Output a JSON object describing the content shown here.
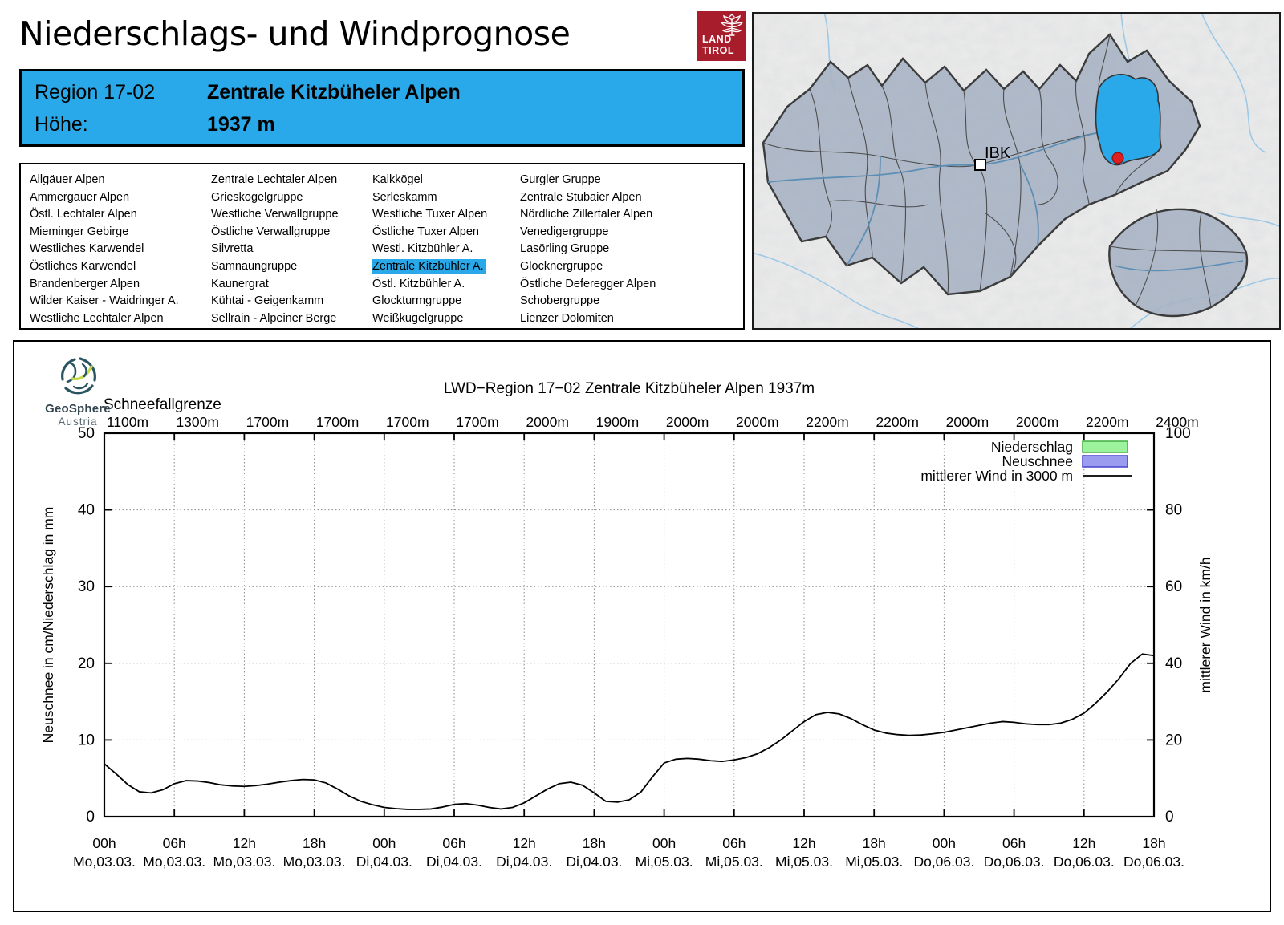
{
  "header": {
    "title": "Niederschlags- und Windprognose",
    "logo_line1": "LAND",
    "logo_line2": "TIROL",
    "logo_color": "#a81d2c"
  },
  "accent_color": "#29a9e9",
  "region_box": {
    "region_label": "Region 17-02",
    "region_name": "Zentrale Kitzbüheler Alpen",
    "hoehe_label": "Höhe:",
    "hoehe_value": "1937 m"
  },
  "region_list": {
    "columns": [
      [
        "Allgäuer Alpen",
        "Ammergauer Alpen",
        "Östl. Lechtaler Alpen",
        "Mieminger Gebirge",
        "Westliches Karwendel",
        "Östliches Karwendel",
        "Brandenberger Alpen",
        "Wilder Kaiser - Waidringer A.",
        "Westliche Lechtaler Alpen"
      ],
      [
        "Zentrale Lechtaler Alpen",
        "Grieskogelgruppe",
        "Westliche Verwallgruppe",
        "Östliche Verwallgruppe",
        "Silvretta",
        "Samnaungruppe",
        "Kaunergrat",
        "Kühtai - Geigenkamm",
        "Sellrain - Alpeiner Berge"
      ],
      [
        "Kalkkögel",
        "Serleskamm",
        "Westliche Tuxer Alpen",
        "Östliche Tuxer Alpen",
        "Westl. Kitzbühler A.",
        "Zentrale Kitzbühler A.",
        "Östl. Kitzbühler A.",
        "Glockturmgruppe",
        "Weißkugelgruppe"
      ],
      [
        "Gurgler Gruppe",
        "Zentrale Stubaier Alpen",
        "Nördliche Zillertaler Alpen",
        "Venedigergruppe",
        "Lasörling Gruppe",
        "Glocknergruppe",
        "Östliche Deferegger Alpen",
        "Schobergruppe",
        "Lienzer Dolomiten"
      ]
    ],
    "selected": {
      "col": 2,
      "row": 5,
      "label": "Zentrale Kitzbühler A."
    }
  },
  "map": {
    "city_label": "IBK",
    "highlight_color": "#29a9e9",
    "region_fill": "#a6b2c3",
    "marker_color": "#de1f1f"
  },
  "branding": {
    "name": "GeoSphere",
    "country": "Austria"
  },
  "chart_data": {
    "type": "line",
    "title": "LWD−Region 17−02 Zentrale Kitzbüheler Alpen 1937m",
    "snowline_title": "Schneefallgrenze",
    "snowline_labels": [
      "1100m",
      "1300m",
      "1700m",
      "1700m",
      "1700m",
      "1700m",
      "2000m",
      "1900m",
      "2000m",
      "2000m",
      "2200m",
      "2200m",
      "2000m",
      "2000m",
      "2200m",
      "2400m"
    ],
    "x_tick_hours": [
      "00h",
      "06h",
      "12h",
      "18h",
      "00h",
      "06h",
      "12h",
      "18h",
      "00h",
      "06h",
      "12h",
      "18h",
      "00h",
      "06h",
      "12h",
      "18h"
    ],
    "x_tick_dates": [
      "Mo,03.03.",
      "Mo,03.03.",
      "Mo,03.03.",
      "Mo,03.03.",
      "Di,04.03.",
      "Di,04.03.",
      "Di,04.03.",
      "Di,04.03.",
      "Mi,05.03.",
      "Mi,05.03.",
      "Mi,05.03.",
      "Mi,05.03.",
      "Do,06.03.",
      "Do,06.03.",
      "Do,06.03.",
      "Do,06.03."
    ],
    "ylabel_left": "Neuschnee in cm/Niederschlag in mm",
    "ylabel_right": "mittlerer Wind in km/h",
    "ylim_left": [
      0,
      50
    ],
    "ylim_right": [
      0,
      100
    ],
    "y_ticks_left": [
      0,
      10,
      20,
      30,
      40,
      50
    ],
    "y_ticks_right": [
      0,
      20,
      40,
      60,
      80,
      100
    ],
    "grid": "dotted",
    "legend_position": "top-right",
    "legend": [
      {
        "label": "Niederschlag",
        "type": "box",
        "fill": "#9df29d",
        "border": "#3fae3f"
      },
      {
        "label": "Neuschnee",
        "type": "box",
        "fill": "#9b9bf0",
        "border": "#4444cc"
      },
      {
        "label": "mittlerer Wind in 3000 m",
        "type": "line",
        "color": "#000000"
      }
    ],
    "x_hours_total": 90,
    "series": [
      {
        "name": "mittlerer Wind in 3000 m",
        "axis": "right",
        "unit": "km/h",
        "x_start_hour": 0,
        "x_step_hours": 1,
        "values": [
          13.8,
          11.2,
          8.4,
          6.5,
          6.2,
          7.0,
          8.6,
          9.4,
          9.3,
          8.9,
          8.3,
          8.0,
          7.9,
          8.1,
          8.5,
          9.0,
          9.4,
          9.7,
          9.6,
          8.8,
          7.2,
          5.4,
          4.0,
          3.1,
          2.4,
          2.1,
          1.9,
          1.9,
          2.0,
          2.5,
          3.2,
          3.4,
          3.0,
          2.4,
          2.0,
          2.4,
          3.6,
          5.4,
          7.2,
          8.6,
          9.0,
          8.2,
          6.2,
          4.0,
          3.8,
          4.4,
          6.4,
          10.4,
          14.0,
          15.0,
          15.2,
          15.0,
          14.6,
          14.4,
          14.8,
          15.4,
          16.4,
          18.0,
          20.0,
          22.4,
          24.8,
          26.6,
          27.2,
          26.8,
          25.6,
          24.0,
          22.6,
          21.8,
          21.4,
          21.2,
          21.3,
          21.6,
          22.0,
          22.6,
          23.2,
          23.8,
          24.4,
          24.8,
          24.6,
          24.2,
          24.0,
          24.0,
          24.4,
          25.4,
          27.0,
          29.6,
          32.6,
          36.0,
          40.0,
          42.4,
          42.0
        ]
      },
      {
        "name": "Niederschlag",
        "axis": "left",
        "unit": "mm",
        "values": []
      },
      {
        "name": "Neuschnee",
        "axis": "left",
        "unit": "cm",
        "values": []
      }
    ]
  }
}
